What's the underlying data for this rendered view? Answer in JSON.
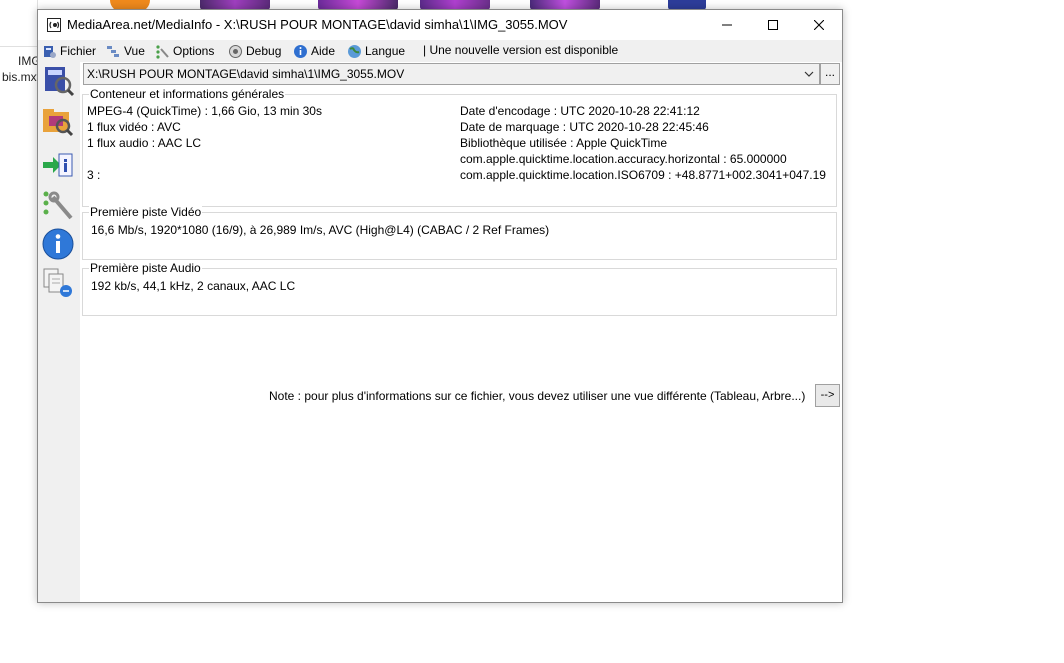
{
  "desktop": {
    "file_label_1": "IMG",
    "file_label_2": "bis.mxt"
  },
  "window": {
    "title": "MediaArea.net/MediaInfo - X:\\RUSH POUR MONTAGE\\david simha\\1\\IMG_3055.MOV",
    "controls": {
      "minimize_icon": "minimize-icon",
      "maximize_icon": "maximize-icon",
      "close_icon": "close-icon"
    }
  },
  "menu": {
    "items": [
      {
        "label": "Fichier",
        "icon": "file-icon"
      },
      {
        "label": "Vue",
        "icon": "view-icon"
      },
      {
        "label": "Options",
        "icon": "options-icon"
      },
      {
        "label": "Debug",
        "icon": "debug-icon"
      },
      {
        "label": "Aide",
        "icon": "help-icon"
      },
      {
        "label": "Langue",
        "icon": "language-icon"
      }
    ],
    "update_note": "| Une nouvelle version est disponible"
  },
  "sidebar": {
    "icons": [
      "open-file-icon",
      "open-folder-icon",
      "export-icon",
      "options-icon",
      "about-icon",
      "knowledge-base-icon"
    ]
  },
  "file_select": {
    "value": "X:\\RUSH POUR MONTAGE\\david simha\\1\\IMG_3055.MOV",
    "browse_label": "..."
  },
  "general": {
    "title": "Conteneur et informations générales",
    "left": [
      "MPEG-4 (QuickTime) : 1,66 Gio, 13 min 30s",
      "1 flux vidéo : AVC",
      "1 flux audio : AAC LC",
      "",
      "3 :"
    ],
    "right": [
      "Date d'encodage : UTC 2020-10-28 22:41:12",
      "Date de marquage : UTC 2020-10-28 22:45:46",
      "Bibliothèque utilisée : Apple QuickTime",
      "com.apple.quicktime.location.accuracy.horizontal : 65.000000",
      "com.apple.quicktime.location.ISO6709 : +48.8771+002.3041+047.19"
    ]
  },
  "video": {
    "title": "Première piste Vidéo",
    "text": "16,6 Mb/s, 1920*1080 (16/9), à 26,989 Im/s, AVC (High@L4) (CABAC / 2 Ref Frames)"
  },
  "audio": {
    "title": "Première piste Audio",
    "text": "192 kb/s, 44,1 kHz, 2 canaux, AAC LC"
  },
  "footer": {
    "note": "Note : pour plus d'informations sur ce fichier, vous devez utiliser une vue différente (Tableau, Arbre...)",
    "button_label": "-->"
  }
}
